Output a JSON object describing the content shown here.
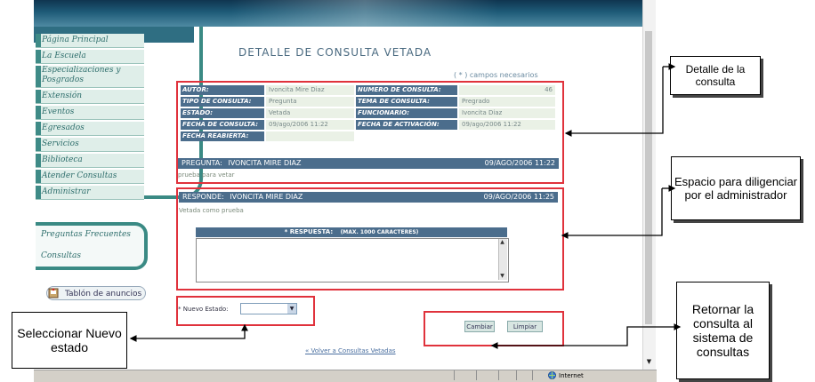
{
  "nav": {
    "items": [
      "Página Principal",
      "La Escuela",
      "Especializaciones y Posgrados",
      "Extensión",
      "Eventos",
      "Egresados",
      "Servicios",
      "Biblioteca",
      "Atender Consultas",
      "Administrar"
    ],
    "secondary": [
      "Preguntas Frecuentes",
      "Consultas"
    ],
    "tablon": "Tablón de anuncios"
  },
  "main": {
    "title": "DETALLE DE CONSULTA VETADA",
    "required_note": "( * ) campos necesarios",
    "fields": {
      "autor_label": "AUTOR:",
      "autor_value": "Ivoncita Mire Diaz",
      "numero_label": "NUMERO DE CONSULTA:",
      "numero_value": "46",
      "tipo_label": "TIPO DE CONSULTA:",
      "tipo_value": "Pregunta",
      "tema_label": "TEMA DE CONSULTA:",
      "tema_value": "Pregrado",
      "estado_label": "ESTADO:",
      "estado_value": "Vetada",
      "funcionario_label": "FUNCIONARIO:",
      "funcionario_value": "Ivoncita Diaz",
      "fecha_label": "FECHA DE CONSULTA:",
      "fecha_value": "09/ago/2006 11:22",
      "activacion_label": "FECHA DE ACTIVACIÓN:",
      "activacion_value": "09/ago/2006 11:22",
      "reabierta_label": "FECHA REABIERTA:",
      "reabierta_value": ""
    },
    "pregunta": {
      "label": "PREGUNTA:",
      "author": "IVONCITA MIRE DIAZ",
      "date": "09/AGO/2006 11:22",
      "text": "prueba para vetar"
    },
    "responde": {
      "label": "RESPONDE:",
      "author": "IVONCITA MIRE DIAZ",
      "date": "09/AGO/2006 11:25",
      "text": "Vetada como prueba"
    },
    "respuesta": {
      "label": "* RESPUESTA:",
      "limit": "(MAX. 1000 CARACTERES)",
      "value": ""
    },
    "nuevo_estado": {
      "label": "* Nuevo Estado:",
      "value": ""
    },
    "buttons": {
      "cambiar": "Cambiar",
      "limpiar": "Limpiar"
    },
    "volver_link": "« Volver a Consultas Vetadas"
  },
  "status": {
    "zone": "Internet"
  },
  "callouts": {
    "detalle": "Detalle de la consulta",
    "espacio": "Espacio para diligenciar por el administrador",
    "seleccionar": "Seleccionar Nuevo estado",
    "retornar": "Retornar la consulta al sistema de consultas"
  },
  "colors": {
    "accent": "#4b6d8c",
    "highlight": "#e0323c",
    "nav": "#3a8a84"
  }
}
